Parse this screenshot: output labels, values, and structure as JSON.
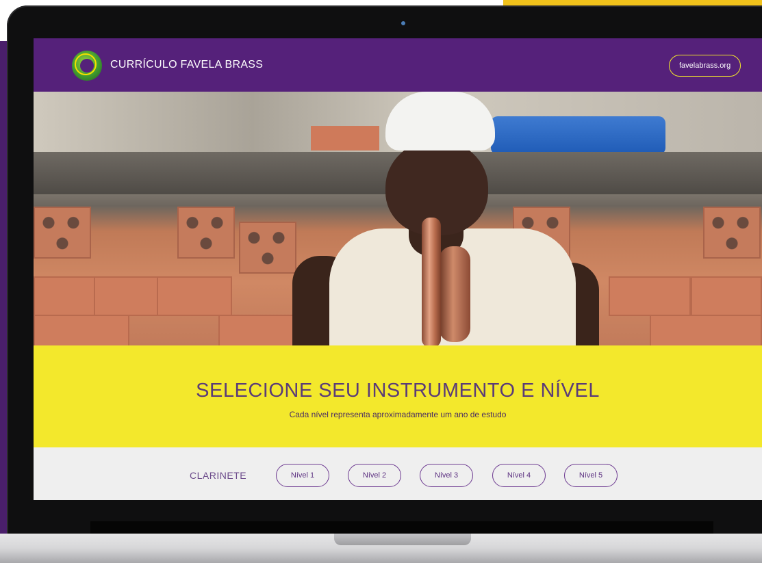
{
  "header": {
    "site_title": "CURRÍCULO FAVELA BRASS",
    "site_link": "favelabrass.org",
    "brand_color": "#55217a",
    "accent_color": "#f4ea2a"
  },
  "hero": {
    "icon": "hero-photo"
  },
  "selection": {
    "title": "SELECIONE SEU INSTRUMENTO E NÍVEL",
    "subtitle": "Cada nível representa aproximadamente um ano de estudo",
    "band_color": "#f3e82c"
  },
  "instrument": {
    "name": "CLARINETE",
    "levels": [
      "Nível 1",
      "Nível 2",
      "Nível 3",
      "Nível 4",
      "Nível 5"
    ]
  }
}
